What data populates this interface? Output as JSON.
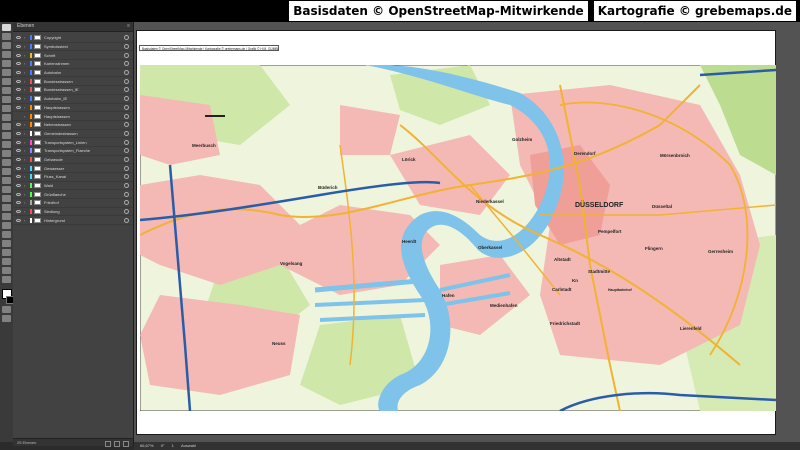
{
  "credits": {
    "osm": "Basisdaten © OpenStreetMap-Mitwirkende",
    "grebe": "Kartografie © grebemaps.de"
  },
  "layers_panel": {
    "title": "Ebenen",
    "footer": "25 Ebenen",
    "layers": [
      {
        "name": "Copyright",
        "color": "#4f7cff",
        "visible": true
      },
      {
        "name": "Symbolsstext",
        "color": "#4f7cff",
        "visible": true
      },
      {
        "name": "Schrift",
        "color": "#f2c200",
        "visible": true
      },
      {
        "name": "Kartenrahmen",
        "color": "#4f7cff",
        "visible": true
      },
      {
        "name": "Autobahn",
        "color": "#4f7cff",
        "visible": true
      },
      {
        "name": "Bundesstrassen",
        "color": "#ff4f4f",
        "visible": true
      },
      {
        "name": "Bundesstrassen_IE",
        "color": "#ff4f4f",
        "visible": true
      },
      {
        "name": "Autobahn_IE",
        "color": "#4f7cff",
        "visible": true
      },
      {
        "name": "Hauptstrassen",
        "color": "#ff8c00",
        "visible": true
      },
      {
        "name": "Hauptstrassen",
        "color": "#ff8c00",
        "visible": false
      },
      {
        "name": "Nebenstrassen",
        "color": "#ff8c00",
        "visible": true
      },
      {
        "name": "Gemeindestrassen",
        "color": "#ffffff",
        "visible": true
      },
      {
        "name": "Transportsystem_Linien",
        "color": "#ff4fd8",
        "visible": true
      },
      {
        "name": "Transportsystem_Flaeche",
        "color": "#8c8cff",
        "visible": true
      },
      {
        "name": "Gebaeude",
        "color": "#ff4f4f",
        "visible": true
      },
      {
        "name": "Gewaesser",
        "color": "#4fd8ff",
        "visible": true
      },
      {
        "name": "Fluss_Kanal",
        "color": "#4fd8ff",
        "visible": true
      },
      {
        "name": "Wald",
        "color": "#4fff4f",
        "visible": true
      },
      {
        "name": "Grünflaeche",
        "color": "#4fff4f",
        "visible": true
      },
      {
        "name": "Friedhof",
        "color": "#aaaaaa",
        "visible": true
      },
      {
        "name": "Siedlung",
        "color": "#ff4f4f",
        "visible": true
      },
      {
        "name": "Hintergrund",
        "color": "#ffffff",
        "visible": true
      }
    ]
  },
  "artboard": {
    "copyright_text": "Basisdaten © OpenStreetMap-Mitwirkende | Kartografie © grebemaps.de | Grafik © H.M. GÜMBELM"
  },
  "statusbar": {
    "zoom": "66,67%",
    "angle": "0°",
    "page": "1",
    "tool": "Auswahl"
  },
  "map_labels": {
    "duesseldorf": "DÜSSELDORF",
    "meerbusch": "Meerbusch",
    "loerick": "Lörick",
    "buederich": "Büderich",
    "golzheim": "Golzheim",
    "derendorf": "Derendorf",
    "moersenbroich": "Mörsenbroich",
    "niederkassel": "Niederkassel",
    "oberkassel": "Oberkassel",
    "heerdt": "Heerdt",
    "vogelsang": "Vogelsang",
    "pempelfort": "Pempelfort",
    "duesseltal": "Düsseltal",
    "flingern": "Flingern",
    "gerresheim": "Gerresheim",
    "altstadt": "Altstadt",
    "stadtmitte": "Stadtmitte",
    "karlstadt": "Carlstadt",
    "hafen": "Hafen",
    "medienhafen": "Medienhafen",
    "friedrichstadt": "Friedrichstadt",
    "lierenfeld": "Lierenfeld",
    "neuss": "Neuss",
    "kn": "Kn",
    "hbf": "Hauptbahnhof"
  }
}
